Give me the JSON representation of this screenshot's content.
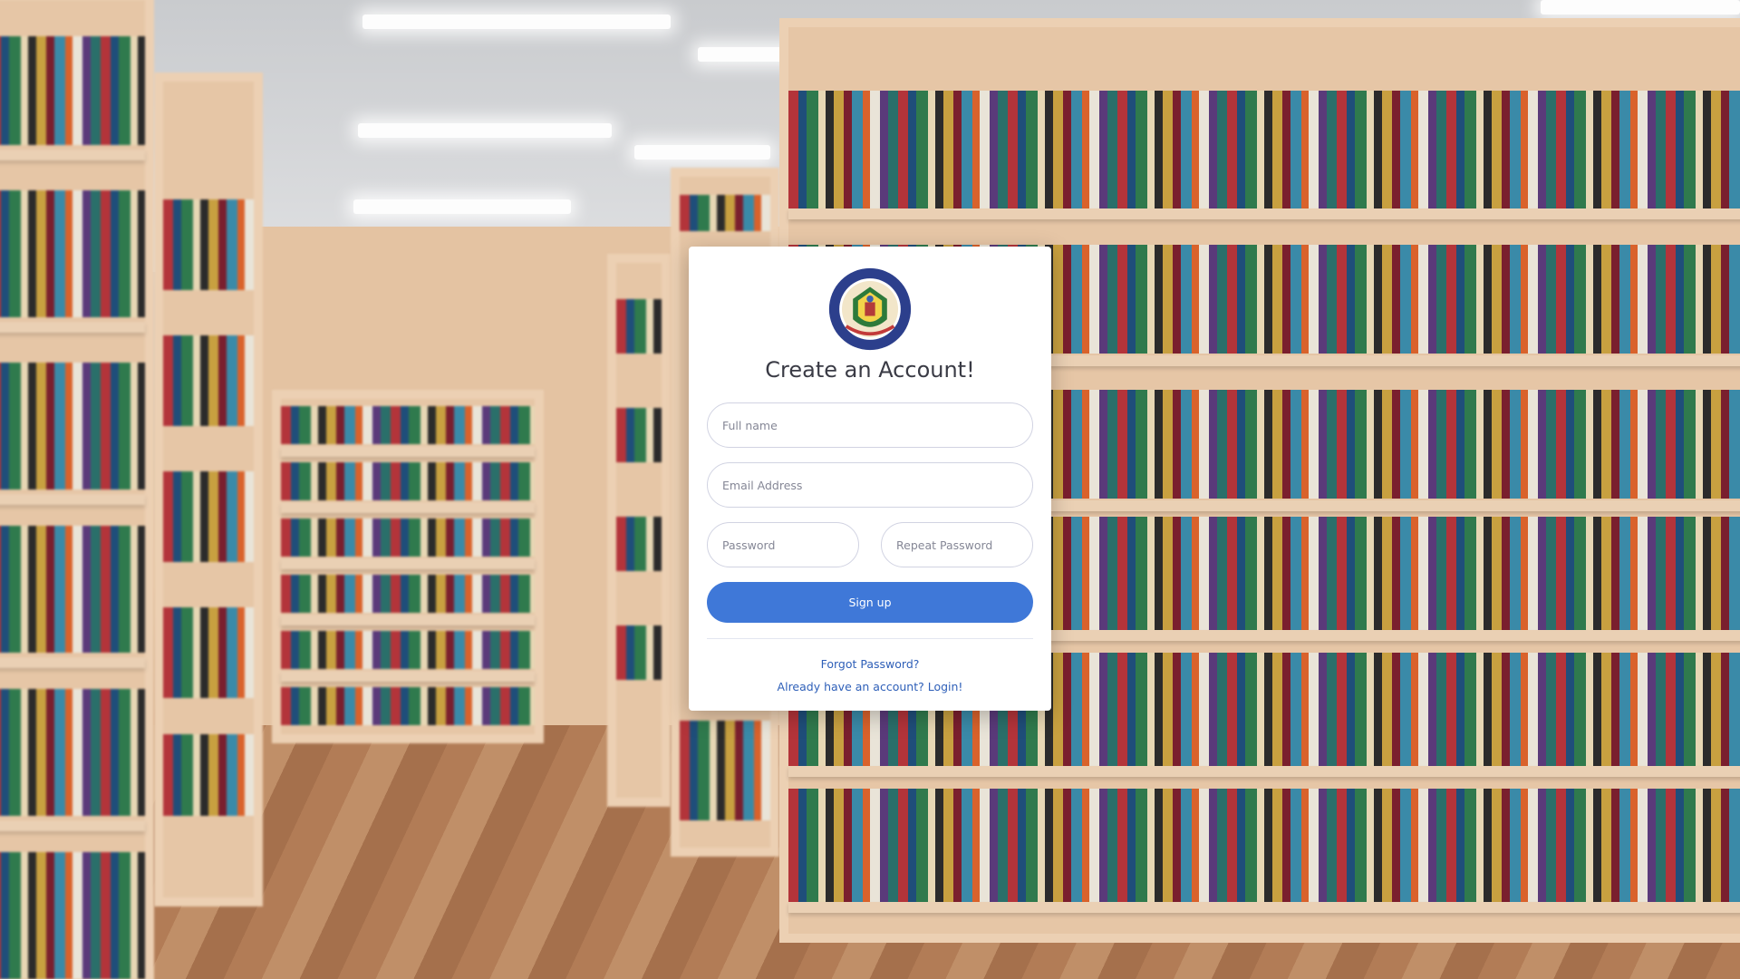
{
  "background": {
    "description_icon": "library-bookshelves-photo"
  },
  "card": {
    "logo_icon": "school-crest-logo",
    "title": "Create an Account!",
    "fields": {
      "full_name_placeholder": "Full name",
      "email_placeholder": "Email Address",
      "password_placeholder": "Password",
      "repeat_password_placeholder": "Repeat Password"
    },
    "signup_label": "Sign up",
    "forgot_password_label": "Forgot Password?",
    "login_label": "Already have an account? Login!"
  },
  "colors": {
    "primary": "#3f78d8",
    "link": "#2e5fb8",
    "card": "#ffffff"
  }
}
